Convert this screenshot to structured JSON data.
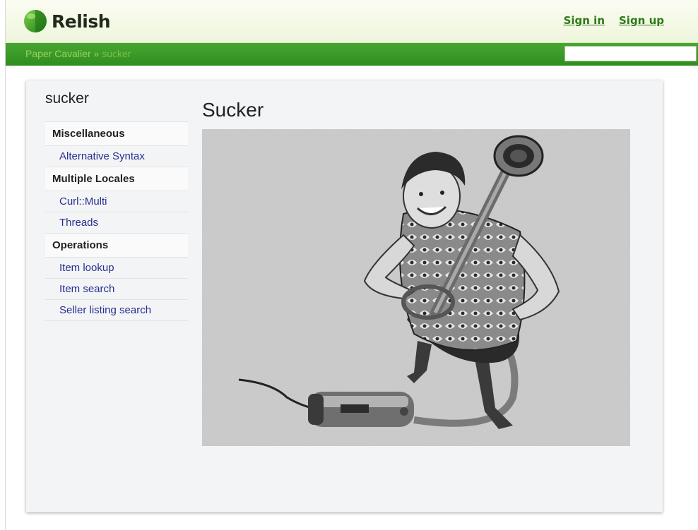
{
  "header": {
    "logo_text": "Relish",
    "sign_in": "Sign in",
    "sign_up": "Sign up"
  },
  "breadcrumb": {
    "parent": "Paper Cavalier",
    "separator": "»",
    "current": "sucker"
  },
  "search": {
    "value": "",
    "placeholder": ""
  },
  "sidebar": {
    "title": "sucker",
    "groups": [
      {
        "label": "Miscellaneous",
        "items": [
          "Alternative Syntax"
        ]
      },
      {
        "label": "Multiple Locales",
        "items": [
          "Curl::Multi",
          "Threads"
        ]
      },
      {
        "label": "Operations",
        "items": [
          "Item lookup",
          "Item search",
          "Seller listing search"
        ]
      }
    ]
  },
  "main": {
    "title": "Sucker",
    "image_subject": "vintage-woman-vacuum-cleaner-illustration"
  },
  "colors": {
    "brand_green": "#3a9a27",
    "link_green": "#2d7a16",
    "sidebar_link": "#272f8f",
    "panel_bg": "#f3f4f6"
  }
}
